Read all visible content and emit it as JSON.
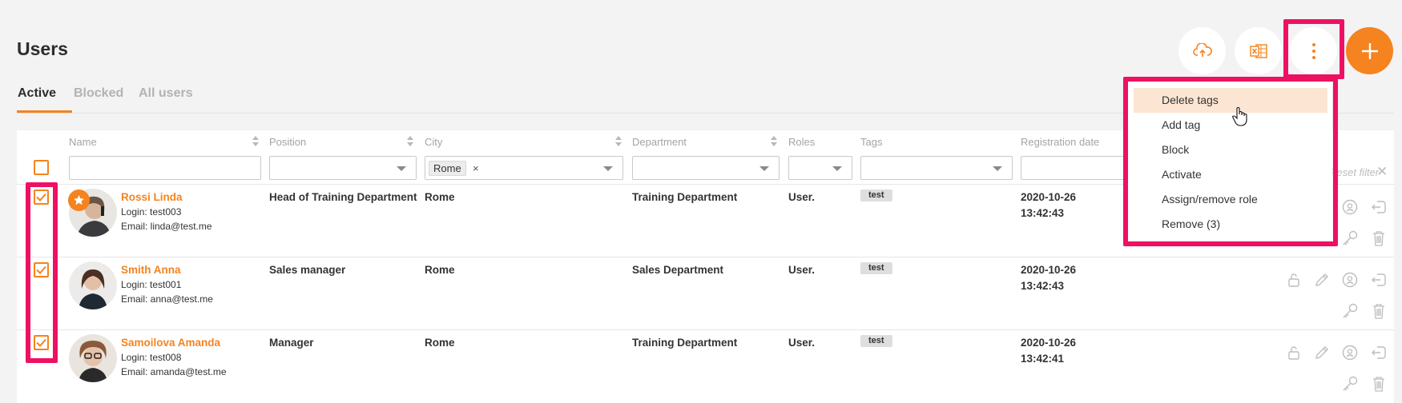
{
  "page": {
    "title": "Users"
  },
  "tabs": {
    "active": "Active",
    "blocked": "Blocked",
    "all": "All users"
  },
  "toolbar": {
    "upload_icon": "cloud-upload-icon",
    "excel_icon": "excel-icon",
    "more_icon": "vertical-dots-icon",
    "add_icon": "plus-icon",
    "accent": "#f5831f",
    "highlight": "#ee1163"
  },
  "columns": {
    "name": "Name",
    "position": "Position",
    "city": "City",
    "department": "Department",
    "roles": "Roles",
    "tags": "Tags",
    "registration_date": "Registration date"
  },
  "filters": {
    "city_chip": "Rome",
    "city_chip_remove": "×",
    "reset": "Reset filter",
    "reset_x": "✕"
  },
  "users": [
    {
      "name": "Rossi Linda",
      "login": "Login: test003",
      "email": "Email: linda@test.me",
      "position": "Head of Training Department",
      "city": "Rome",
      "department": "Training Department",
      "roles": "User.",
      "tag": "test",
      "date": "2020-10-26",
      "time": "13:42:43"
    },
    {
      "name": "Smith Anna",
      "login": "Login: test001",
      "email": "Email: anna@test.me",
      "position": "Sales manager",
      "city": "Rome",
      "department": "Sales Department",
      "roles": "User.",
      "tag": "test",
      "date": "2020-10-26",
      "time": "13:42:43"
    },
    {
      "name": "Samoilova Amanda",
      "login": "Login: test008",
      "email": "Email: amanda@test.me",
      "position": "Manager",
      "city": "Rome",
      "department": "Training Department",
      "roles": "User.",
      "tag": "test",
      "date": "2020-10-26",
      "time": "13:42:41"
    }
  ],
  "menu": {
    "delete_tags": "Delete tags",
    "add_tag": "Add tag",
    "block": "Block",
    "activate": "Activate",
    "assign_role": "Assign/remove role",
    "remove": "Remove (3)"
  }
}
